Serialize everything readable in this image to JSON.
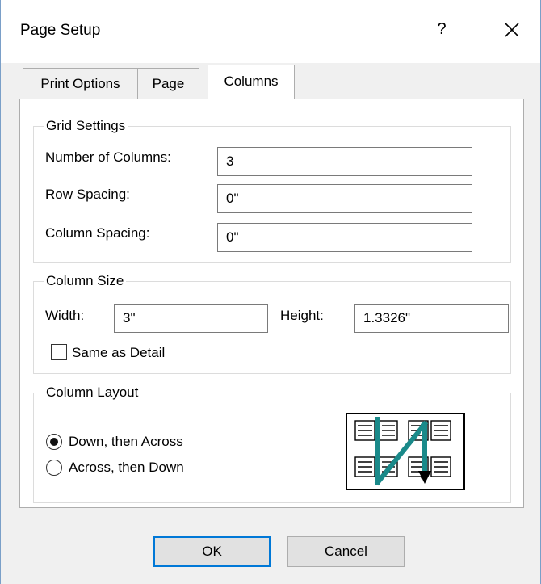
{
  "dialog": {
    "title": "Page Setup",
    "help_label": "?"
  },
  "tabs": [
    {
      "label": "Print Options"
    },
    {
      "label": "Page"
    },
    {
      "label": "Columns"
    }
  ],
  "active_tab": "Columns",
  "grid_settings": {
    "title": "Grid Settings",
    "num_columns_label": "Number of Columns:",
    "num_columns_value": "3",
    "row_spacing_label": "Row Spacing:",
    "row_spacing_value": "0\"",
    "column_spacing_label": "Column Spacing:",
    "column_spacing_value": "0\""
  },
  "column_size": {
    "title": "Column Size",
    "width_label": "Width:",
    "width_value": "3\"",
    "height_label": "Height:",
    "height_value": "1.3326\"",
    "same_as_detail_label": "Same as Detail",
    "same_as_detail_checked": false
  },
  "column_layout": {
    "title": "Column Layout",
    "options": [
      {
        "label": "Down, then Across",
        "selected": true
      },
      {
        "label": "Across, then Down",
        "selected": false
      }
    ]
  },
  "buttons": {
    "ok_label": "OK",
    "cancel_label": "Cancel"
  },
  "colors": {
    "accent": "#0078d7",
    "arrow": "#1a8a8a"
  }
}
